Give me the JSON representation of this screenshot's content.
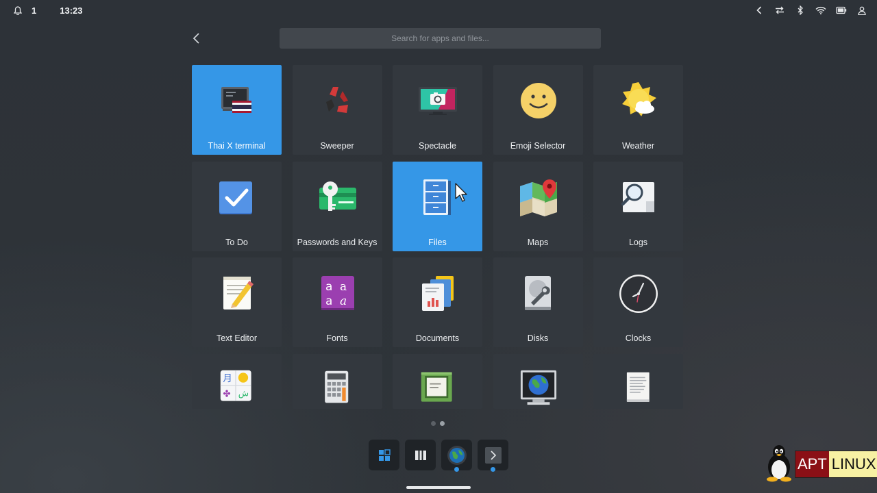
{
  "status_bar": {
    "notifications_count": "1",
    "time": "13:23",
    "icons": [
      "bell-icon",
      "chevron-left-icon",
      "transfer-icon",
      "bluetooth-icon",
      "wifi-icon",
      "battery-icon",
      "user-icon"
    ]
  },
  "search": {
    "placeholder": "Search for apps and files..."
  },
  "apps": [
    {
      "label": "Thai X terminal",
      "icon": "terminal-thai-icon",
      "active": true
    },
    {
      "label": "Sweeper",
      "icon": "sweeper-icon"
    },
    {
      "label": "Spectacle",
      "icon": "spectacle-icon"
    },
    {
      "label": "Emoji Selector",
      "icon": "emoji-icon"
    },
    {
      "label": "Weather",
      "icon": "weather-icon"
    },
    {
      "label": "To Do",
      "icon": "todo-icon"
    },
    {
      "label": "Passwords and Keys",
      "icon": "key-icon"
    },
    {
      "label": "Files",
      "icon": "files-icon",
      "active": true
    },
    {
      "label": "Maps",
      "icon": "maps-icon"
    },
    {
      "label": "Logs",
      "icon": "logs-icon"
    },
    {
      "label": "Text Editor",
      "icon": "text-editor-icon"
    },
    {
      "label": "Fonts",
      "icon": "fonts-icon"
    },
    {
      "label": "Documents",
      "icon": "documents-icon"
    },
    {
      "label": "Disks",
      "icon": "disks-icon"
    },
    {
      "label": "Clocks",
      "icon": "clocks-icon"
    },
    {
      "label": "",
      "icon": "characters-icon"
    },
    {
      "label": "",
      "icon": "calculator-icon"
    },
    {
      "label": "",
      "icon": "cpu-icon"
    },
    {
      "label": "",
      "icon": "system-monitor-icon"
    },
    {
      "label": "",
      "icon": "document-viewer-icon"
    }
  ],
  "pager": {
    "pages": 2,
    "current": 2
  },
  "dock": [
    {
      "icon": "app-grid-icon",
      "running": false
    },
    {
      "icon": "workspaces-icon",
      "running": false
    },
    {
      "icon": "browser-globe-icon",
      "running": true
    },
    {
      "icon": "terminal-icon",
      "running": true
    }
  ],
  "watermark": {
    "part1": "APT",
    "part2": "LINUX"
  },
  "colors": {
    "accent": "#3597e7",
    "tile": "#33383e",
    "background": "#2b3035"
  }
}
